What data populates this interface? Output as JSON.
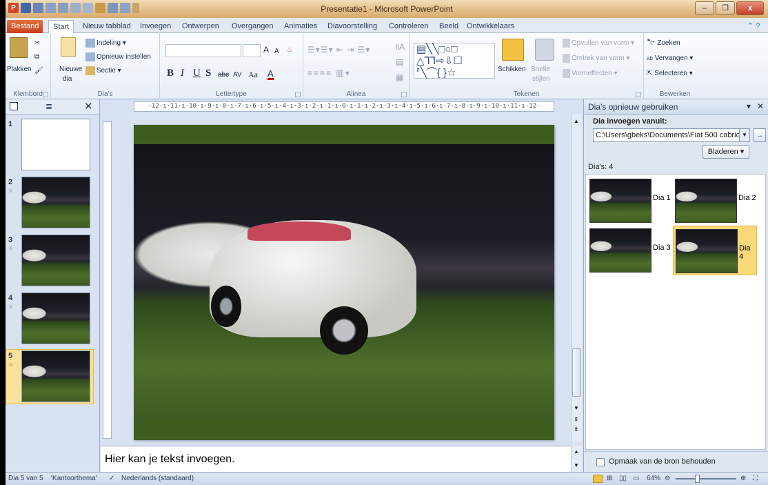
{
  "window": {
    "title": "Presentatie1 - Microsoft PowerPoint",
    "controls": [
      "–",
      "❐",
      "x"
    ]
  },
  "ribbon_tabs": [
    "Bestand",
    "Start",
    "Nieuw tabblad",
    "Invoegen",
    "Ontwerpen",
    "Overgangen",
    "Animaties",
    "Diavoorstelling",
    "Controleren",
    "Beeld",
    "Ontwikkelaars"
  ],
  "ribbon": {
    "clipboard": {
      "paste": "Plakken",
      "label": "Klembord"
    },
    "slides": {
      "new_slide": "Nieuwe",
      "new_slide_2": "dia",
      "layout": "Indeling",
      "reset": "Opnieuw instellen",
      "section": "Sectie",
      "label": "Dia's"
    },
    "font": {
      "bold": "B",
      "italic": "I",
      "underline": "U",
      "shadow": "S",
      "strike": "abc",
      "spacing": "AV",
      "case": "Aa",
      "grow": "A",
      "shrink": "A",
      "label": "Lettertype"
    },
    "paragraph": {
      "label": "Alinea"
    },
    "drawing": {
      "arrange": "Schikken",
      "quick_styles": "Snelle",
      "quick_styles_2": "stijlen",
      "fill": "Opvullen van vorm",
      "outline": "Omtrek van vorm",
      "effects": "Vormeffecten",
      "label": "Tekenen"
    },
    "editing": {
      "find": "Zoeken",
      "replace": "Vervangen",
      "select": "Selecteren",
      "label": "Bewerken"
    }
  },
  "ruler_text": "·12·ı·11·ı·10·ı·9·ı·8·ı·7·ı·6·ı·5·ı·4·ı·3·ı·2·ı·1·ı·0·ı·1·ı·2·ı·3·ı·4·ı·5·ı·6·ı·7·ı·8·ı·9·ı·10·ı·11·ı·12·",
  "slides_panel": {
    "thumbs": [
      {
        "num": "1",
        "blank": true
      },
      {
        "num": "2",
        "blank": false
      },
      {
        "num": "3",
        "blank": false
      },
      {
        "num": "4",
        "blank": false
      },
      {
        "num": "5",
        "blank": false
      }
    ]
  },
  "notes": {
    "placeholder": "Hier kan je tekst invoegen."
  },
  "task_pane": {
    "title": "Dia's opnieuw gebruiken",
    "insert_from_label": "Dia invoegen vanuit:",
    "path": "C:\\Users\\gbeks\\Documents\\Fiat 500 cabrio.",
    "browse": "Bladeren",
    "count_label": "Dia's: 4",
    "slides": [
      "Dia 1",
      "Dia 2",
      "Dia 3",
      "Dia 4"
    ],
    "keep_format": "Opmaak van de bron behouden"
  },
  "status": {
    "slide_info": "Dia 5 van 5",
    "theme": "'Kantoorthema'",
    "language": "Nederlands (standaard)",
    "zoom": "64%"
  },
  "colors": {
    "file_tab": "#c5421a",
    "selection": "#fbd879",
    "slide_background": "#3d5c1d"
  }
}
